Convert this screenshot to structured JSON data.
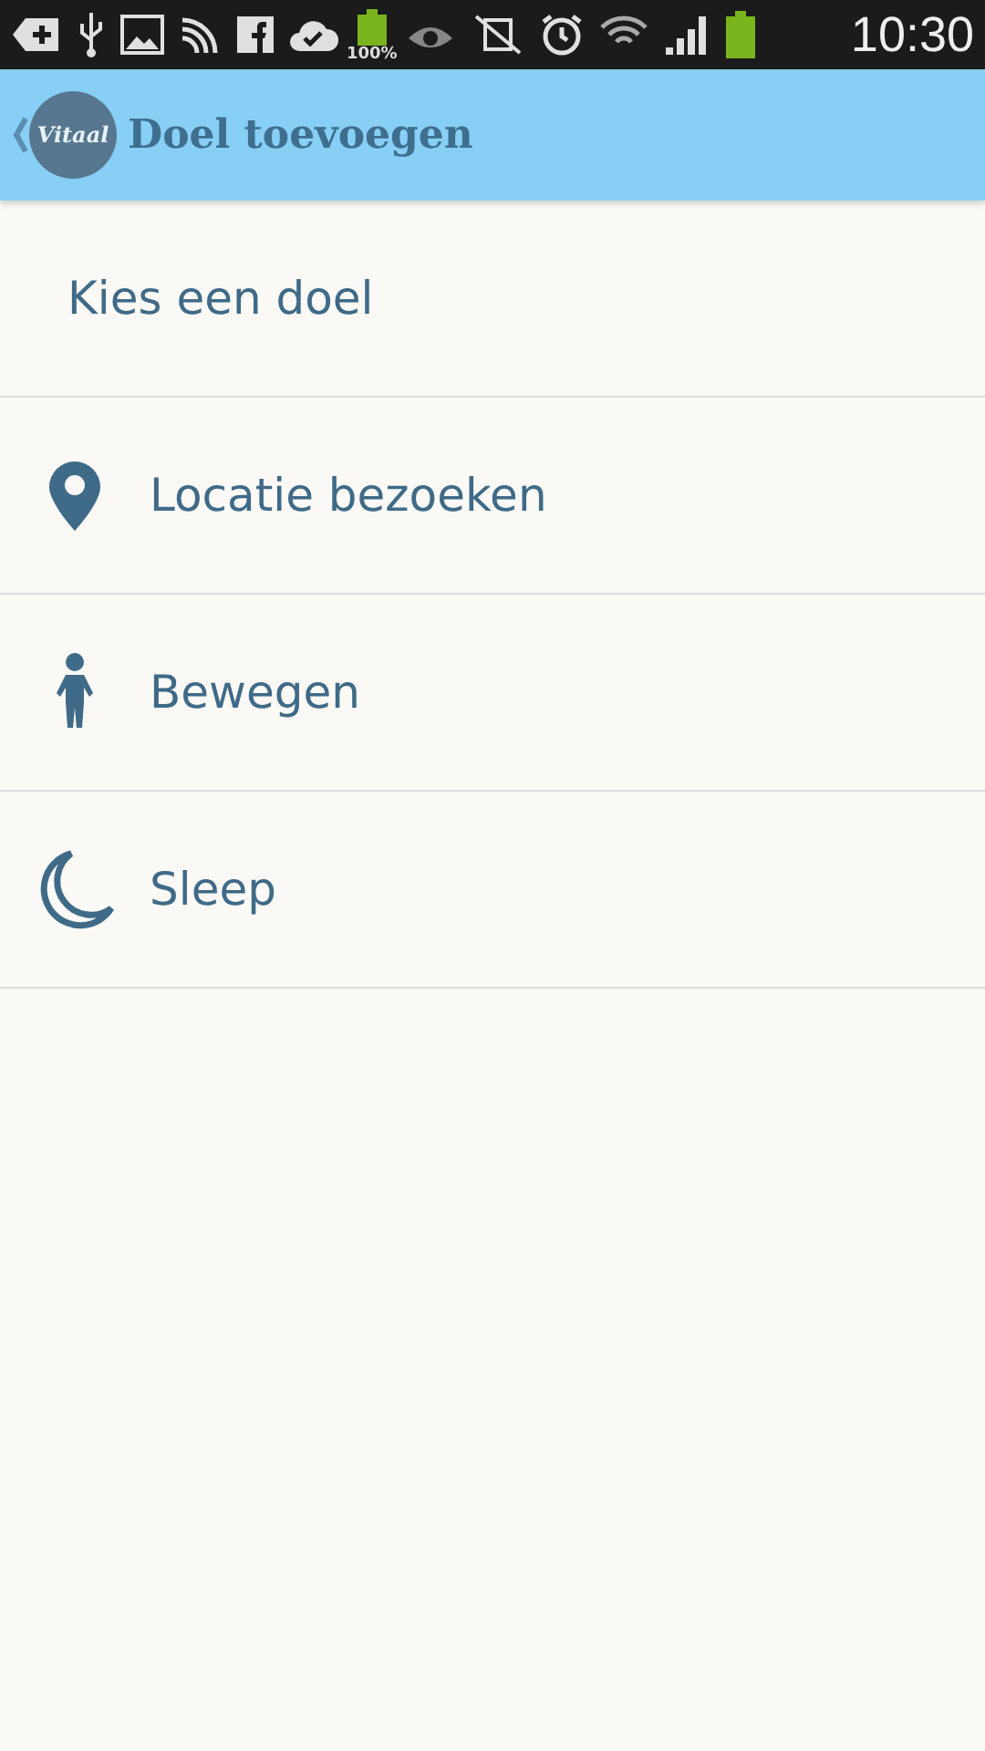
{
  "status_bar": {
    "battery_label": "100%",
    "time": "10:30"
  },
  "app_bar": {
    "logo": "Vitaal",
    "title": "Doel toevoegen"
  },
  "heading": "Kies een doel",
  "goals": [
    {
      "kind": "location",
      "label": "Locatie bezoeken"
    },
    {
      "kind": "walk",
      "label": "Bewegen"
    },
    {
      "kind": "sleep",
      "label": "Sleep"
    }
  ]
}
